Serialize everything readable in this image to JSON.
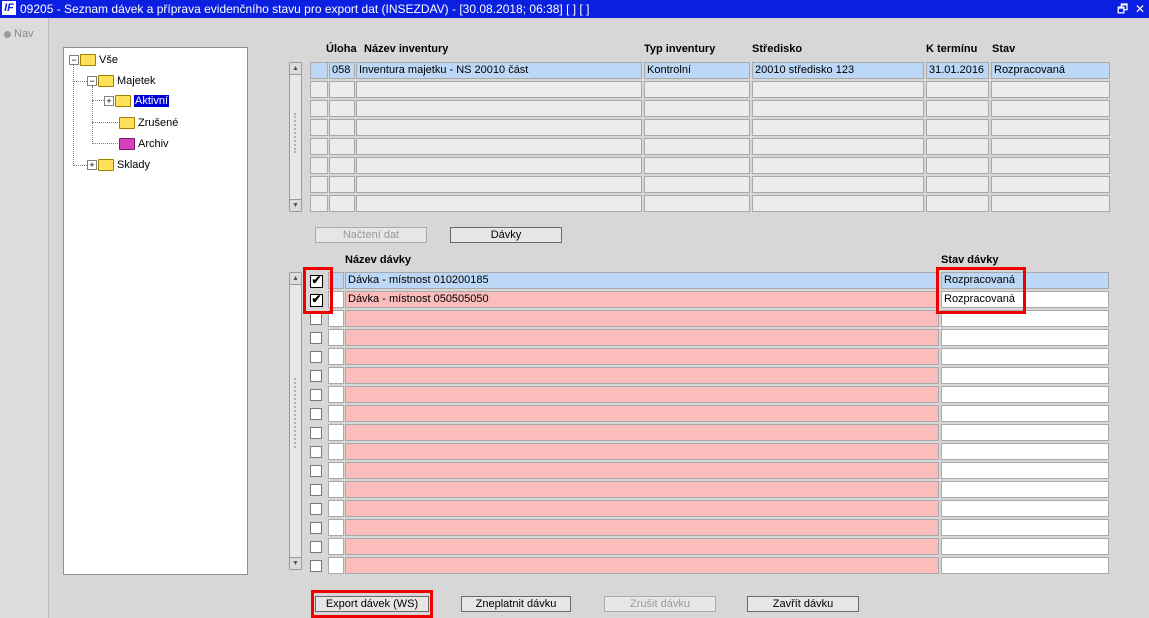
{
  "window": {
    "title": "09205 - Seznam dávek a příprava evidenčního stavu pro export dat (INSEZDAV) - [30.08.2018; 06:38]  [ ]  [ ]",
    "logo": "IF",
    "restore_glyph": "🗗",
    "close_glyph": "✕"
  },
  "nav": {
    "label": "Nav"
  },
  "tree": {
    "root": "Vše",
    "majetek": "Majetek",
    "aktivni": "Aktivní",
    "zrusene": "Zrušené",
    "archiv": "Archiv",
    "sklady": "Sklady",
    "expanded_glyph": "−",
    "collapsed_glyph": "+"
  },
  "inventory_table": {
    "headers": {
      "uloha": "Úloha",
      "nazev": "Název inventury",
      "typ": "Typ inventury",
      "stredisko": "Středisko",
      "termin": "K termínu",
      "stav": "Stav"
    },
    "rows": [
      {
        "uloha": "058",
        "nazev": "Inventura majetku - NS 20010 část",
        "typ": "Kontrolní",
        "stredisko": "20010 středisko 123",
        "termin": "31.01.2016",
        "stav": "Rozpracovaná"
      },
      {
        "uloha": "",
        "nazev": "",
        "typ": "",
        "stredisko": "",
        "termin": "",
        "stav": ""
      },
      {
        "uloha": "",
        "nazev": "",
        "typ": "",
        "stredisko": "",
        "termin": "",
        "stav": ""
      },
      {
        "uloha": "",
        "nazev": "",
        "typ": "",
        "stredisko": "",
        "termin": "",
        "stav": ""
      },
      {
        "uloha": "",
        "nazev": "",
        "typ": "",
        "stredisko": "",
        "termin": "",
        "stav": ""
      },
      {
        "uloha": "",
        "nazev": "",
        "typ": "",
        "stredisko": "",
        "termin": "",
        "stav": ""
      },
      {
        "uloha": "",
        "nazev": "",
        "typ": "",
        "stredisko": "",
        "termin": "",
        "stav": ""
      },
      {
        "uloha": "",
        "nazev": "",
        "typ": "",
        "stredisko": "",
        "termin": "",
        "stav": ""
      }
    ]
  },
  "mid_buttons": {
    "nacteni": "Načtení dat",
    "davky": "Dávky"
  },
  "batch_table": {
    "headers": {
      "nazev": "Název dávky",
      "stav": "Stav dávky"
    },
    "check_glyph": "✔",
    "rows": [
      {
        "checked": true,
        "nazev": "Dávka - místnost 010200185",
        "stav": "Rozpracovaná"
      },
      {
        "checked": true,
        "nazev": "Dávka - místnost 050505050",
        "stav": "Rozpracovaná"
      },
      {
        "checked": false,
        "nazev": "",
        "stav": ""
      },
      {
        "checked": false,
        "nazev": "",
        "stav": ""
      },
      {
        "checked": false,
        "nazev": "",
        "stav": ""
      },
      {
        "checked": false,
        "nazev": "",
        "stav": ""
      },
      {
        "checked": false,
        "nazev": "",
        "stav": ""
      },
      {
        "checked": false,
        "nazev": "",
        "stav": ""
      },
      {
        "checked": false,
        "nazev": "",
        "stav": ""
      },
      {
        "checked": false,
        "nazev": "",
        "stav": ""
      },
      {
        "checked": false,
        "nazev": "",
        "stav": ""
      },
      {
        "checked": false,
        "nazev": "",
        "stav": ""
      },
      {
        "checked": false,
        "nazev": "",
        "stav": ""
      },
      {
        "checked": false,
        "nazev": "",
        "stav": ""
      },
      {
        "checked": false,
        "nazev": "",
        "stav": ""
      },
      {
        "checked": false,
        "nazev": "",
        "stav": ""
      }
    ]
  },
  "bottom_buttons": {
    "export": "Export dávek (WS)",
    "zneplatnit": "Zneplatnit dávku",
    "zrusit": "Zrušit dávku",
    "zavrit": "Zavřít dávku"
  },
  "colors": {
    "titlebar": "#0a1fe0",
    "row_highlight": "#bcd8f6",
    "row_pink": "#fbbcbc",
    "annotation_red": "#ee0000",
    "tree_selection": "#0000d8"
  }
}
